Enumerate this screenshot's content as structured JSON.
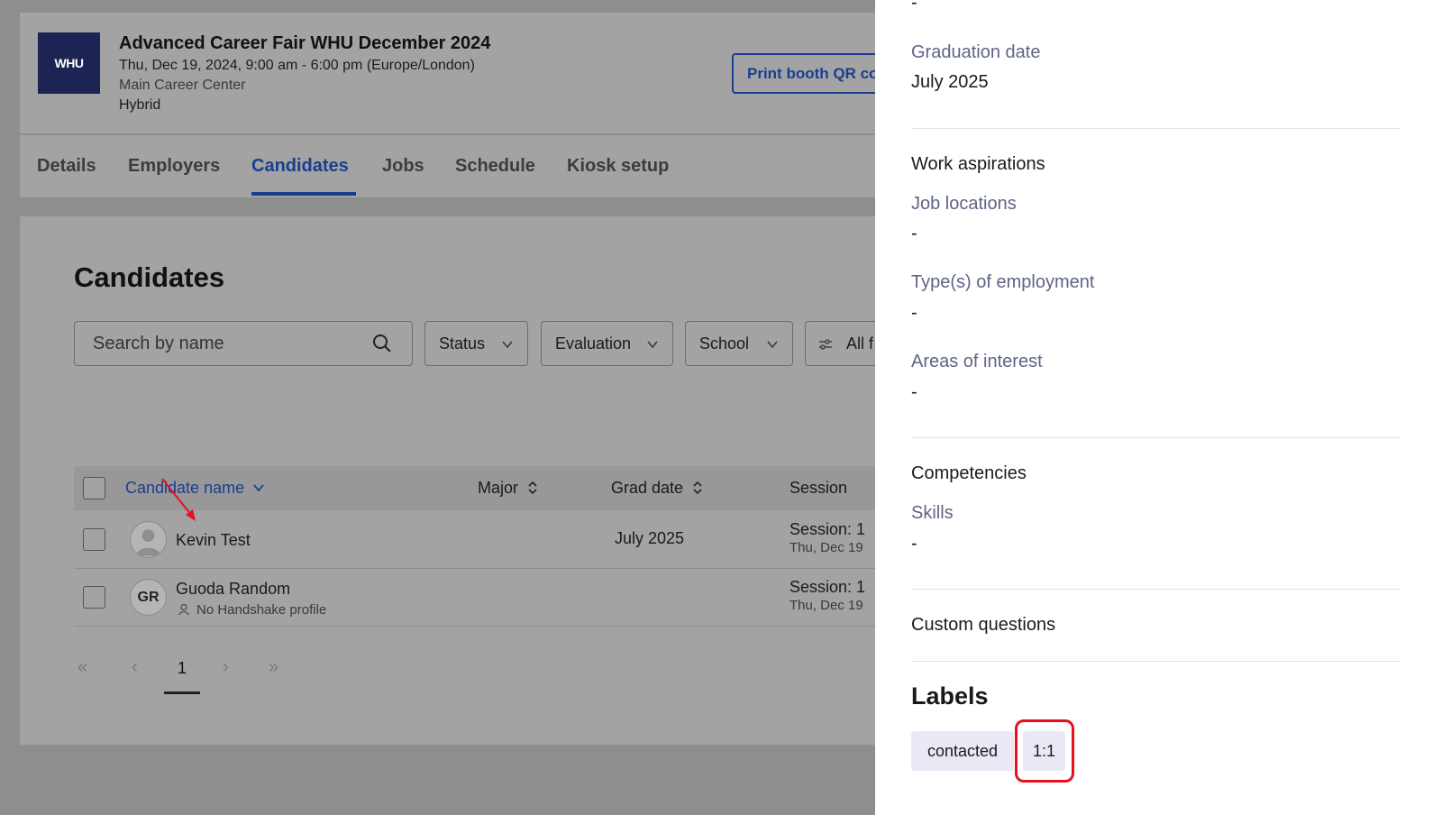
{
  "event": {
    "logo_text": "WHU",
    "title": "Advanced Career Fair WHU December 2024",
    "datetime": "Thu, Dec 19, 2024, 9:00 am - 6:00 pm (Europe/London)",
    "location": "Main Career Center",
    "format": "Hybrid",
    "print_button": "Print booth QR co"
  },
  "tabs": [
    "Details",
    "Employers",
    "Candidates",
    "Jobs",
    "Schedule",
    "Kiosk setup"
  ],
  "candidates": {
    "heading": "Candidates",
    "search_placeholder": "Search by name",
    "filters": [
      "Status",
      "Evaluation",
      "School",
      "All f"
    ],
    "columns": {
      "name": "Candidate name",
      "major": "Major",
      "grad_date": "Grad date",
      "session": "Session"
    },
    "rows": [
      {
        "name": "Kevin Test",
        "initials": "",
        "sub": "",
        "grad_date": "July 2025",
        "session": "Session: 1",
        "session_date": "Thu, Dec 19"
      },
      {
        "name": "Guoda Random",
        "initials": "GR",
        "sub": "No Handshake profile",
        "grad_date": "",
        "session": "Session: 1",
        "session_date": "Thu, Dec 19"
      }
    ],
    "pagination": {
      "first": "«",
      "prev": "‹",
      "current": "1",
      "next": "›",
      "last": "»"
    }
  },
  "drawer": {
    "top_value": "-",
    "graduation_label": "Graduation date",
    "graduation_value": "July 2025",
    "work_section": "Work aspirations",
    "job_locations_label": "Job locations",
    "job_locations_value": "-",
    "employment_label": "Type(s) of employment",
    "employment_value": "-",
    "interest_label": "Areas of interest",
    "interest_value": "-",
    "competencies_section": "Competencies",
    "skills_label": "Skills",
    "skills_value": "-",
    "custom_section": "Custom questions",
    "labels_heading": "Labels",
    "labels": [
      "contacted",
      "1:1"
    ]
  },
  "colors": {
    "brand_blue": "#1a3e8f",
    "annotation_red": "#e8101e",
    "chip_bg": "#e8e9f4",
    "label_gray": "#5f6488"
  }
}
